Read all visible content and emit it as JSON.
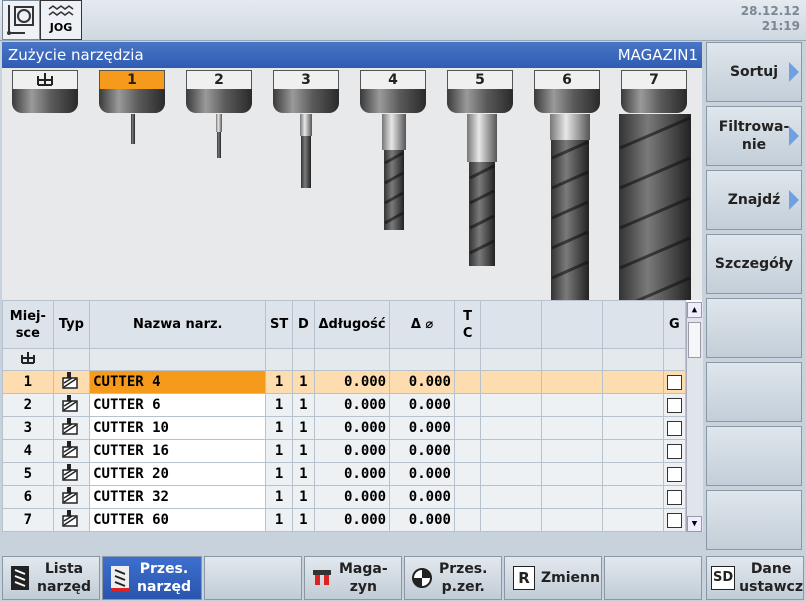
{
  "top": {
    "mode_label": "JOG",
    "date": "28.12.12",
    "time": "21:19"
  },
  "title": {
    "left": "Zużycie narzędzia",
    "right": "MAGAZIN1"
  },
  "holders": [
    "1",
    "2",
    "3",
    "4",
    "5",
    "6",
    "7"
  ],
  "table": {
    "headers": {
      "place": "Miej-\nsce",
      "type": "Typ",
      "name": "Nazwa narz.",
      "st": "ST",
      "d": "D",
      "dlen": "Δdługość",
      "ddia": "Δ ⌀",
      "tc": "T\nC",
      "g": "G"
    },
    "rows": [
      {
        "place": "1",
        "name": "CUTTER 4",
        "st": "1",
        "d": "1",
        "dlen": "0.000",
        "ddia": "0.000"
      },
      {
        "place": "2",
        "name": "CUTTER 6",
        "st": "1",
        "d": "1",
        "dlen": "0.000",
        "ddia": "0.000"
      },
      {
        "place": "3",
        "name": "CUTTER 10",
        "st": "1",
        "d": "1",
        "dlen": "0.000",
        "ddia": "0.000"
      },
      {
        "place": "4",
        "name": "CUTTER 16",
        "st": "1",
        "d": "1",
        "dlen": "0.000",
        "ddia": "0.000"
      },
      {
        "place": "5",
        "name": "CUTTER 20",
        "st": "1",
        "d": "1",
        "dlen": "0.000",
        "ddia": "0.000"
      },
      {
        "place": "6",
        "name": "CUTTER 32",
        "st": "1",
        "d": "1",
        "dlen": "0.000",
        "ddia": "0.000"
      },
      {
        "place": "7",
        "name": "CUTTER 60",
        "st": "1",
        "d": "1",
        "dlen": "0.000",
        "ddia": "0.000"
      }
    ]
  },
  "right_keys": {
    "sort": "Sortuj",
    "filter_1": "Filtrowa-",
    "filter_2": "nie",
    "find": "Znajdź",
    "details": "Szczegóły"
  },
  "bottom_keys": {
    "tool_list_1": "Lista",
    "tool_list_2": "narzęd",
    "tool_wear_1": "Przes.",
    "tool_wear_2": "narzęd",
    "magazine_1": "Maga-",
    "magazine_2": "zyn",
    "work_offset_1": "Przes.",
    "work_offset_2": "p.zer.",
    "variables": "Zmienn",
    "setting_1": "Dane",
    "setting_2": "ustawcz",
    "r_icon": "R",
    "sd_icon": "SD"
  },
  "colors": {
    "accent": "#2f5cb3",
    "selection": "#f59a1a"
  }
}
